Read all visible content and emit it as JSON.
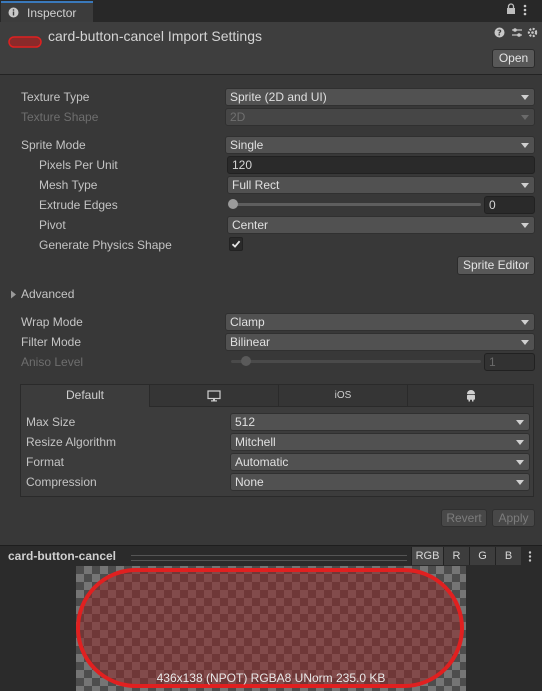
{
  "tab": {
    "title": "Inspector",
    "icon": "info-icon"
  },
  "header": {
    "title": "card-button-cancel Import Settings",
    "open_label": "Open"
  },
  "settings": {
    "texture_type": {
      "label": "Texture Type",
      "value": "Sprite (2D and UI)"
    },
    "texture_shape": {
      "label": "Texture Shape",
      "value": "2D"
    },
    "sprite_mode": {
      "label": "Sprite Mode",
      "value": "Single"
    },
    "pixels_per_unit": {
      "label": "Pixels Per Unit",
      "value": "120"
    },
    "mesh_type": {
      "label": "Mesh Type",
      "value": "Full Rect"
    },
    "extrude_edges": {
      "label": "Extrude Edges",
      "value": "0",
      "slider_fraction": 0
    },
    "pivot": {
      "label": "Pivot",
      "value": "Center"
    },
    "generate_physics": {
      "label": "Generate Physics Shape",
      "checked": true
    },
    "sprite_editor_label": "Sprite Editor",
    "advanced_label": "Advanced",
    "wrap_mode": {
      "label": "Wrap Mode",
      "value": "Clamp"
    },
    "filter_mode": {
      "label": "Filter Mode",
      "value": "Bilinear"
    },
    "aniso_level": {
      "label": "Aniso Level",
      "value": "1",
      "slider_fraction": 0.05
    }
  },
  "platform": {
    "tabs": [
      {
        "label": "Default",
        "icon": ""
      },
      {
        "label": "",
        "icon": "monitor-icon"
      },
      {
        "label": "iOS",
        "icon": ""
      },
      {
        "label": "",
        "icon": "android-icon"
      }
    ],
    "max_size": {
      "label": "Max Size",
      "value": "512"
    },
    "resize_algorithm": {
      "label": "Resize Algorithm",
      "value": "Mitchell"
    },
    "format": {
      "label": "Format",
      "value": "Automatic"
    },
    "compression": {
      "label": "Compression",
      "value": "None"
    }
  },
  "actions": {
    "revert_label": "Revert",
    "apply_label": "Apply"
  },
  "preview": {
    "title": "card-button-cancel",
    "channels": [
      "RGB",
      "R",
      "G",
      "B"
    ],
    "info": "436x138 (NPOT)  RGBA8 UNorm  235.0 KB"
  },
  "colors": {
    "accent": "#3a79bb",
    "sprite_outline": "#e02020"
  }
}
